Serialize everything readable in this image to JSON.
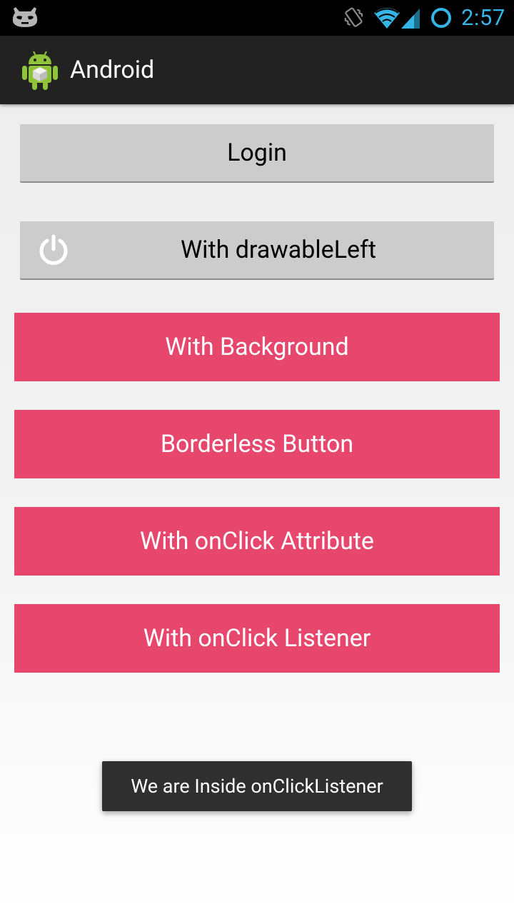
{
  "status_bar": {
    "time": "2:57",
    "icons": [
      "cyanogenmod-icon",
      "vibrate-icon",
      "wifi-icon",
      "signal-icon",
      "ring-icon"
    ],
    "clock_color": "#33b5e5"
  },
  "action_bar": {
    "title": "Android",
    "icon": "android-robot-icon",
    "background": "#222222"
  },
  "buttons": {
    "login": "Login",
    "drawable_left": "With drawableLeft",
    "drawable_left_icon": "power-icon",
    "with_background": "With Background",
    "borderless": "Borderless Button",
    "onclick_attribute": "With onClick Attribute",
    "onclick_listener": "With onClick Listener",
    "accent_color": "#e7476d",
    "gray_color": "#cccccc"
  },
  "toast": {
    "message": "We are Inside onClickListener"
  }
}
